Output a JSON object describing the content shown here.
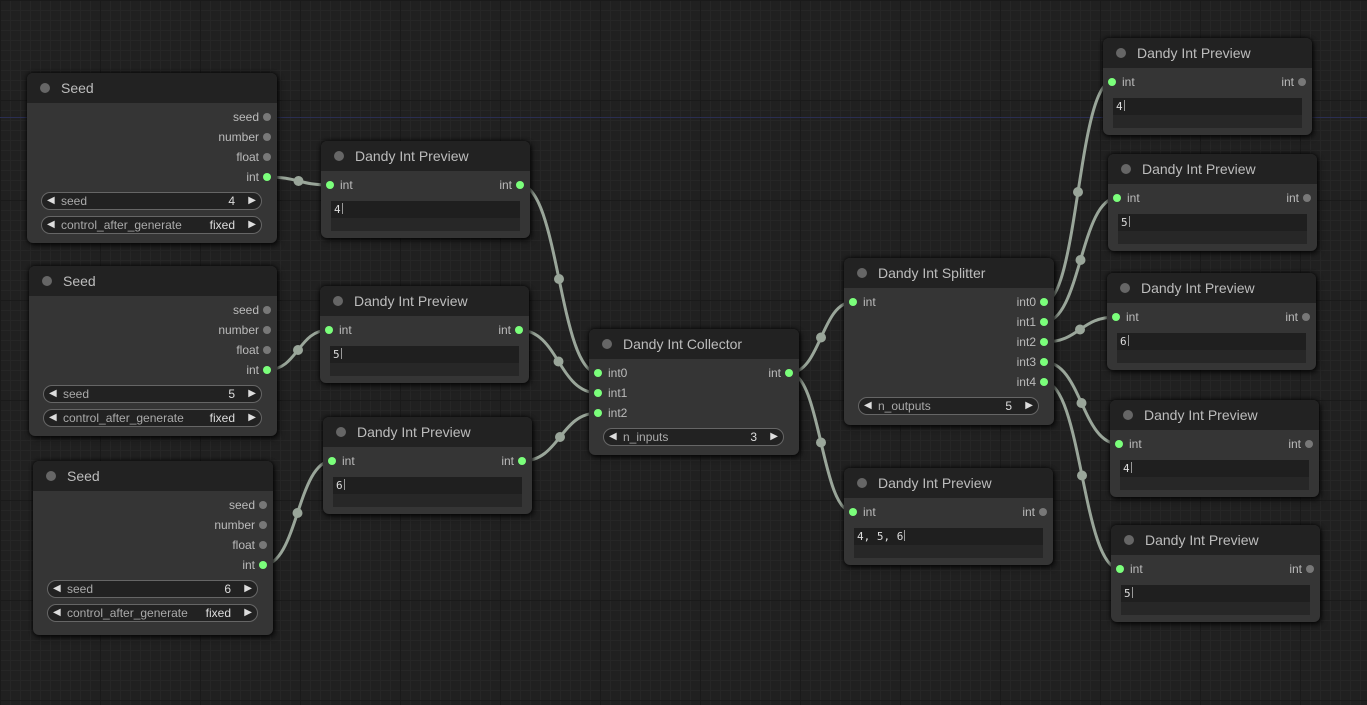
{
  "canvas": {
    "background": "#202020",
    "link_color": "#9aa69a",
    "slot_connected": "#7bff7b",
    "slot_unconnected": "#787878"
  },
  "nodes": [
    {
      "id": "seed1",
      "title": "Seed",
      "outputs": [
        {
          "label": "seed",
          "connected": false
        },
        {
          "label": "number",
          "connected": false
        },
        {
          "label": "float",
          "connected": false
        },
        {
          "label": "int",
          "connected": true
        }
      ],
      "widgets": [
        {
          "name": "seed",
          "value": "4"
        },
        {
          "name": "control_after_generate",
          "value": "fixed"
        }
      ]
    },
    {
      "id": "seed2",
      "title": "Seed",
      "outputs": [
        {
          "label": "seed",
          "connected": false
        },
        {
          "label": "number",
          "connected": false
        },
        {
          "label": "float",
          "connected": false
        },
        {
          "label": "int",
          "connected": true
        }
      ],
      "widgets": [
        {
          "name": "seed",
          "value": "5"
        },
        {
          "name": "control_after_generate",
          "value": "fixed"
        }
      ]
    },
    {
      "id": "seed3",
      "title": "Seed",
      "outputs": [
        {
          "label": "seed",
          "connected": false
        },
        {
          "label": "number",
          "connected": false
        },
        {
          "label": "float",
          "connected": false
        },
        {
          "label": "int",
          "connected": true
        }
      ],
      "widgets": [
        {
          "name": "seed",
          "value": "6"
        },
        {
          "name": "control_after_generate",
          "value": "fixed"
        }
      ]
    },
    {
      "id": "prev1",
      "title": "Dandy Int Preview",
      "inputs": [
        {
          "label": "int",
          "connected": true
        }
      ],
      "outputs": [
        {
          "label": "int",
          "connected": true
        }
      ],
      "text": "4"
    },
    {
      "id": "prev2",
      "title": "Dandy Int Preview",
      "inputs": [
        {
          "label": "int",
          "connected": true
        }
      ],
      "outputs": [
        {
          "label": "int",
          "connected": true
        }
      ],
      "text": "5"
    },
    {
      "id": "prev3",
      "title": "Dandy Int Preview",
      "inputs": [
        {
          "label": "int",
          "connected": true
        }
      ],
      "outputs": [
        {
          "label": "int",
          "connected": true
        }
      ],
      "text": "6"
    },
    {
      "id": "collector",
      "title": "Dandy Int Collector",
      "inputs": [
        {
          "label": "int0",
          "connected": true
        },
        {
          "label": "int1",
          "connected": true
        },
        {
          "label": "int2",
          "connected": true
        }
      ],
      "outputs": [
        {
          "label": "int",
          "connected": true
        }
      ],
      "widgets": [
        {
          "name": "n_inputs",
          "value": "3"
        }
      ]
    },
    {
      "id": "splitter",
      "title": "Dandy Int Splitter",
      "inputs": [
        {
          "label": "int",
          "connected": true
        }
      ],
      "outputs": [
        {
          "label": "int0",
          "connected": true
        },
        {
          "label": "int1",
          "connected": true
        },
        {
          "label": "int2",
          "connected": true
        },
        {
          "label": "int3",
          "connected": true
        },
        {
          "label": "int4",
          "connected": true
        }
      ],
      "widgets": [
        {
          "name": "n_outputs",
          "value": "5"
        }
      ]
    },
    {
      "id": "prevList",
      "title": "Dandy Int Preview",
      "inputs": [
        {
          "label": "int",
          "connected": true
        }
      ],
      "outputs": [
        {
          "label": "int",
          "connected": false
        }
      ],
      "text": "4, 5, 6"
    },
    {
      "id": "prevA",
      "title": "Dandy Int Preview",
      "inputs": [
        {
          "label": "int",
          "connected": true
        }
      ],
      "outputs": [
        {
          "label": "int",
          "connected": false
        }
      ],
      "text": "4"
    },
    {
      "id": "prevB",
      "title": "Dandy Int Preview",
      "inputs": [
        {
          "label": "int",
          "connected": true
        }
      ],
      "outputs": [
        {
          "label": "int",
          "connected": false
        }
      ],
      "text": "5"
    },
    {
      "id": "prevC",
      "title": "Dandy Int Preview",
      "inputs": [
        {
          "label": "int",
          "connected": true
        }
      ],
      "outputs": [
        {
          "label": "int",
          "connected": false
        }
      ],
      "text": "6"
    },
    {
      "id": "prevD",
      "title": "Dandy Int Preview",
      "inputs": [
        {
          "label": "int",
          "connected": true
        }
      ],
      "outputs": [
        {
          "label": "int",
          "connected": false
        }
      ],
      "text": "4"
    },
    {
      "id": "prevE",
      "title": "Dandy Int Preview",
      "inputs": [
        {
          "label": "int",
          "connected": true
        }
      ],
      "outputs": [
        {
          "label": "int",
          "connected": false
        }
      ],
      "text": "5"
    }
  ],
  "links": [
    {
      "from": "seed1",
      "out": 3,
      "to": "prev1",
      "in": 0
    },
    {
      "from": "seed2",
      "out": 3,
      "to": "prev2",
      "in": 0
    },
    {
      "from": "seed3",
      "out": 3,
      "to": "prev3",
      "in": 0
    },
    {
      "from": "prev1",
      "out": 0,
      "to": "collector",
      "in": 0
    },
    {
      "from": "prev2",
      "out": 0,
      "to": "collector",
      "in": 1
    },
    {
      "from": "prev3",
      "out": 0,
      "to": "collector",
      "in": 2
    },
    {
      "from": "collector",
      "out": 0,
      "to": "splitter",
      "in": 0
    },
    {
      "from": "collector",
      "out": 0,
      "to": "prevList",
      "in": 0
    },
    {
      "from": "splitter",
      "out": 0,
      "to": "prevA",
      "in": 0
    },
    {
      "from": "splitter",
      "out": 1,
      "to": "prevB",
      "in": 0
    },
    {
      "from": "splitter",
      "out": 2,
      "to": "prevC",
      "in": 0
    },
    {
      "from": "splitter",
      "out": 3,
      "to": "prevD",
      "in": 0
    },
    {
      "from": "splitter",
      "out": 4,
      "to": "prevE",
      "in": 0
    }
  ]
}
